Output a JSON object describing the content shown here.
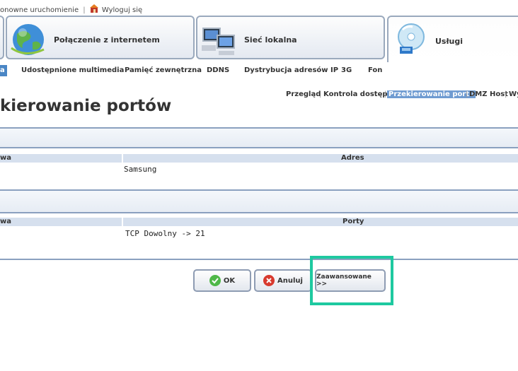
{
  "top_links": {
    "restart": "onowne uruchomienie",
    "separator": "|",
    "logout": "Wyloguj się"
  },
  "main_tabs": {
    "internet": "Połączenie z internetem",
    "lan": "Sieć lokalna",
    "services": "Usługi"
  },
  "submenu": {
    "active": "a",
    "items": [
      "Udostępnione multimedia",
      "Pamięć zewnętrzna",
      "DDNS",
      "Dystrybucja adresów IP",
      "3G",
      "Fon"
    ]
  },
  "right_nav": {
    "items": [
      "Przegląd",
      "Kontrola dostępu",
      "Przekierowanie portu",
      "DMZ Host",
      "Wy"
    ],
    "active_index": 2
  },
  "page_title": "kierowanie portów",
  "table1": {
    "col_left": "wa",
    "col_right": "Adres",
    "value": "Samsung"
  },
  "table2": {
    "col_left": "wa",
    "col_right": "Porty",
    "value": "TCP Dowolny -> 21"
  },
  "buttons": {
    "ok": "OK",
    "cancel": "Anuluj",
    "advanced": "Zaawansowane >>"
  }
}
